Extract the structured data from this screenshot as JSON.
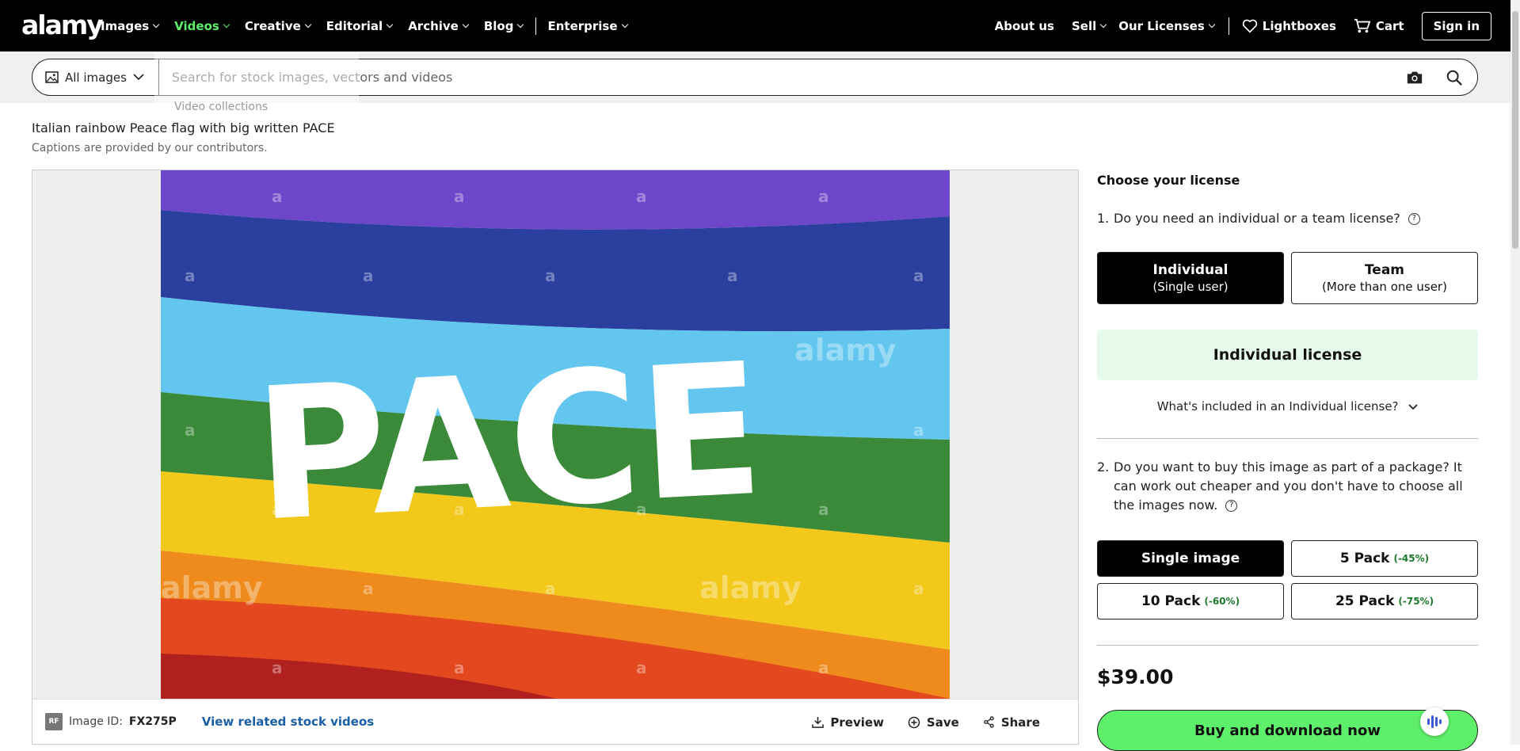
{
  "nav": {
    "logo": "alamy",
    "left_items": [
      {
        "label": "Images"
      },
      {
        "label": "Videos"
      },
      {
        "label": "Creative"
      },
      {
        "label": "Editorial"
      },
      {
        "label": "Archive"
      },
      {
        "label": "Blog"
      }
    ],
    "enterprise": "Enterprise",
    "about": "About us",
    "sell": "Sell",
    "licenses": "Our Licenses",
    "lightboxes": "Lightboxes",
    "cart": "Cart",
    "signin": "Sign in",
    "active_color": "#5ef06a"
  },
  "search": {
    "scope": "All images",
    "placeholder": "Search for stock images, vectors and videos"
  },
  "ghost_menu": {
    "item1": "Video collections"
  },
  "caption": {
    "title": "Italian rainbow Peace flag with big written PACE",
    "note": "Captions are provided by our contributors."
  },
  "image": {
    "flag_word": "PACE",
    "watermark": "alamy",
    "stripe_colors": [
      "#6e46c9",
      "#2b3f9e",
      "#63c6ef",
      "#3a8a3a",
      "#f2c81a",
      "#ef8a1c",
      "#e3481f",
      "#b0201e"
    ]
  },
  "image_footer": {
    "rf": "RF",
    "id_label": "Image ID:",
    "id_value": "FX275P",
    "related": "View related stock videos",
    "preview": "Preview",
    "save": "Save",
    "share": "Share"
  },
  "license": {
    "heading": "Choose your license",
    "q1_num": "1.",
    "q1": "Do you need an individual or a team license?",
    "individual_title": "Individual",
    "individual_sub": "(Single user)",
    "team_title": "Team",
    "team_sub": "(More than one user)",
    "selected_license": "Individual license",
    "included": "What's included in an Individual license?",
    "q2_num": "2.",
    "q2": "Do you want to buy this image as part of a package? It can work out cheaper and you don't have to choose all the images now.",
    "packs": [
      {
        "label": "Single image",
        "discount": ""
      },
      {
        "label": "5 Pack",
        "discount": "(-45%)"
      },
      {
        "label": "10 Pack",
        "discount": "(-60%)"
      },
      {
        "label": "25 Pack",
        "discount": "(-75%)"
      }
    ],
    "price": "$39.00",
    "buy": "Buy and download now"
  }
}
